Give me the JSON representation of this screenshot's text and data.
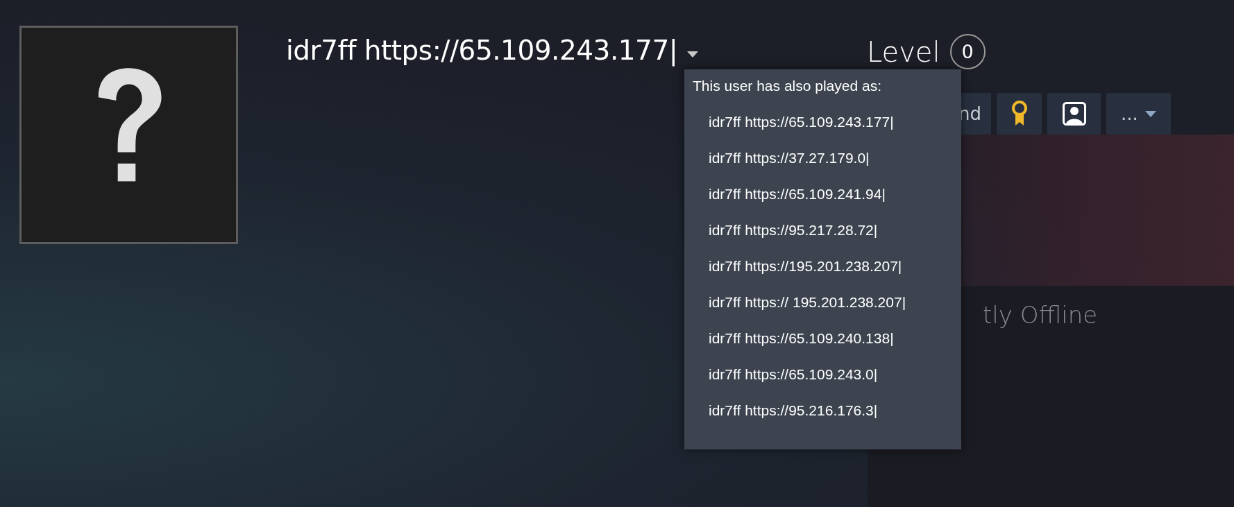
{
  "profile": {
    "name": "idr7ff https://65.109.243.177|",
    "name_history": {
      "expanded": true,
      "title": "This user has also played as:",
      "names": [
        "idr7ff https://65.109.243.177|",
        "idr7ff https://37.27.179.0|",
        "idr7ff https://65.109.241.94|",
        "idr7ff https://95.217.28.72|",
        "idr7ff https://195.201.238.207|",
        "idr7ff https:// 195.201.238.207|",
        "idr7ff https://65.109.240.138|",
        "idr7ff https://65.109.243.0|",
        "idr7ff https://95.216.176.3|"
      ]
    },
    "level": {
      "label": "Level",
      "value": "0"
    },
    "buttons": [
      {
        "kind": "text",
        "label": "nd"
      },
      {
        "kind": "badge"
      },
      {
        "kind": "avatar"
      },
      {
        "kind": "more",
        "label": "..."
      }
    ],
    "status": "tly Offline"
  }
}
